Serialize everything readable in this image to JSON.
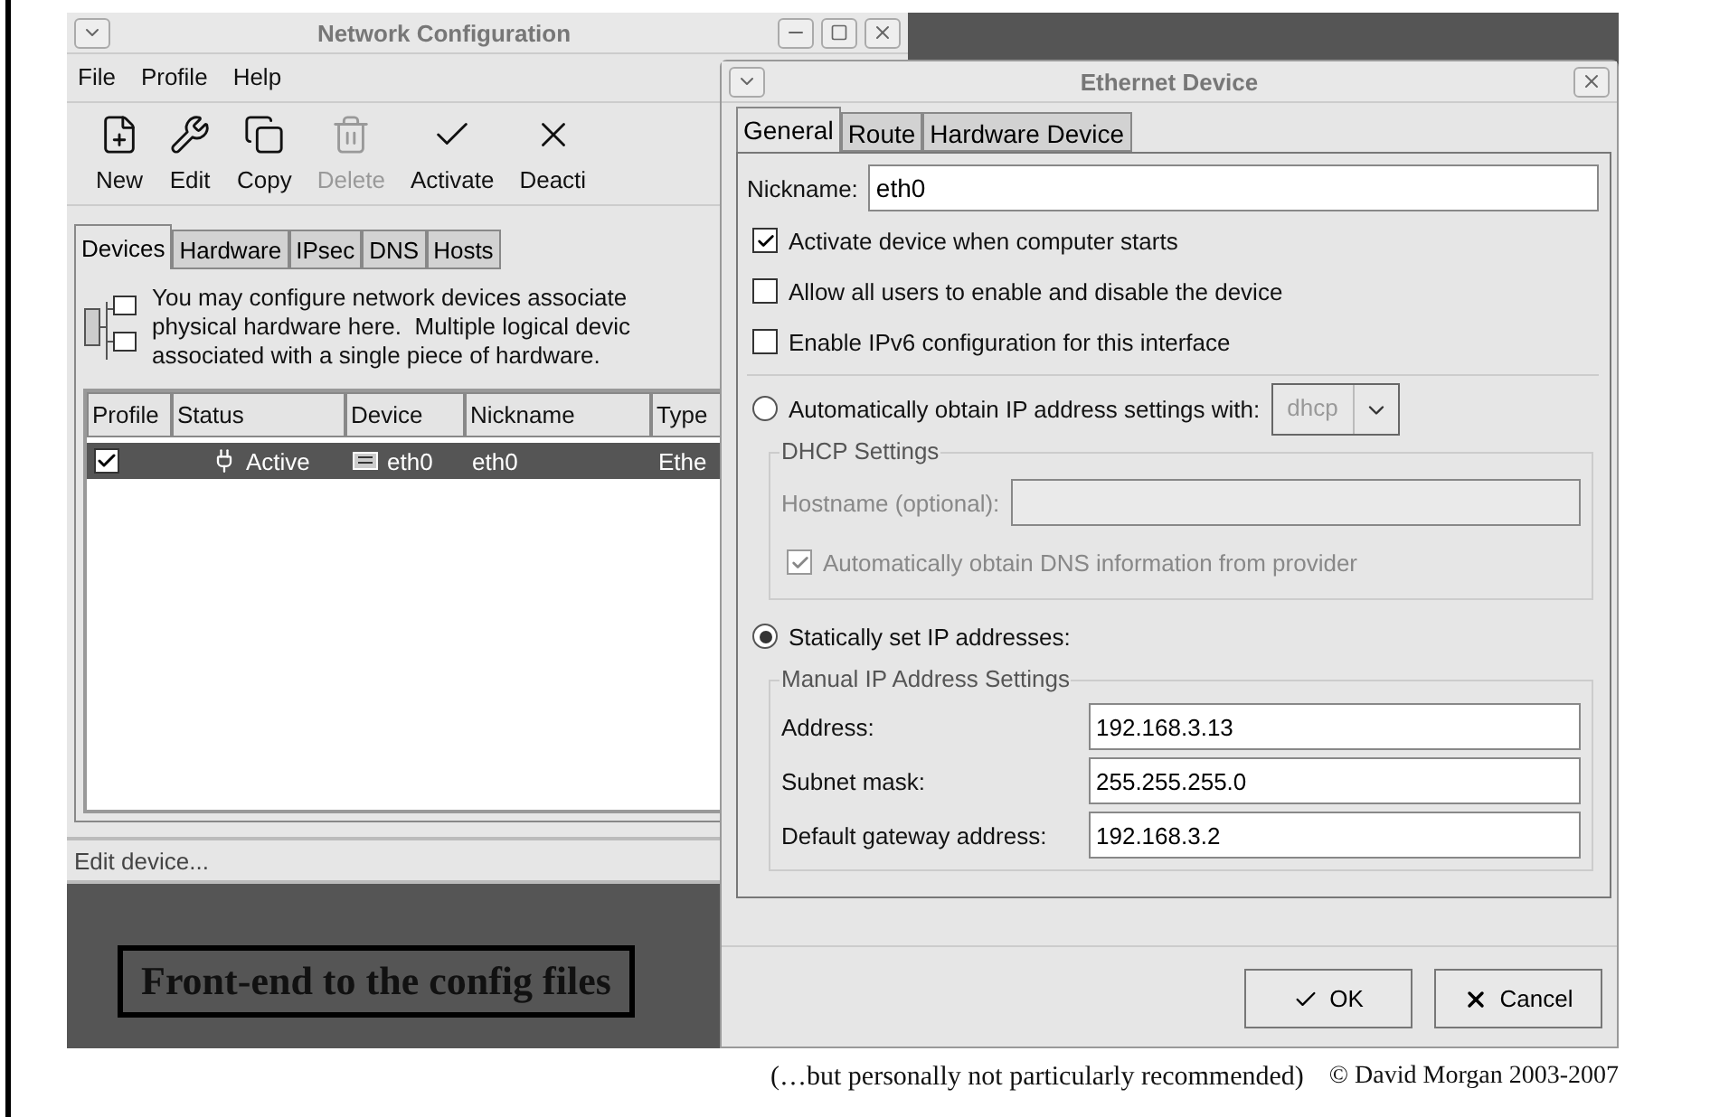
{
  "main_window": {
    "title": "Network Configuration",
    "menu": [
      "File",
      "Profile",
      "Help"
    ],
    "toolbar": [
      {
        "kind": "new",
        "label": "New",
        "disabled": false
      },
      {
        "kind": "edit",
        "label": "Edit",
        "disabled": false
      },
      {
        "kind": "copy",
        "label": "Copy",
        "disabled": false
      },
      {
        "kind": "delete",
        "label": "Delete",
        "disabled": true
      },
      {
        "kind": "activate",
        "label": "Activate",
        "disabled": false
      },
      {
        "kind": "deactivate",
        "label": "Deacti",
        "disabled": false
      }
    ],
    "tabs": [
      {
        "label": "Devices",
        "selected": true
      },
      {
        "label": "Hardware",
        "selected": false
      },
      {
        "label": "IPsec",
        "selected": false
      },
      {
        "label": "DNS",
        "selected": false
      },
      {
        "label": "Hosts",
        "selected": false
      }
    ],
    "info_lines": [
      "You may configure network devices associate",
      "physical hardware here.  Multiple logical devic",
      "associated with a single piece of hardware."
    ],
    "table": {
      "columns": [
        "Profile",
        "Status",
        "Device",
        "Nickname",
        "Type"
      ],
      "rows": [
        {
          "selected": true,
          "profile_checked": true,
          "status": "Active",
          "device": "eth0",
          "nickname": "eth0",
          "type": "Ethe"
        }
      ]
    },
    "status_bar": "Edit device..."
  },
  "dialog": {
    "title": "Ethernet Device",
    "tabs": [
      {
        "label": "General",
        "selected": true
      },
      {
        "label": "Route",
        "selected": false
      },
      {
        "label": "Hardware Device",
        "selected": false
      }
    ],
    "nickname": {
      "label": "Nickname:",
      "value": "eth0"
    },
    "checkboxes": [
      {
        "label": "Activate device when computer starts",
        "checked": true
      },
      {
        "label": "Allow all users to enable and disable the device",
        "checked": false
      },
      {
        "label": "Enable IPv6 configuration for this interface",
        "checked": false
      }
    ],
    "auto_ip": {
      "label": "Automatically obtain IP address settings with:",
      "selected": false,
      "combo": "dhcp"
    },
    "dhcp": {
      "title": "DHCP Settings",
      "disabled": true,
      "hostname_label": "Hostname (optional):",
      "dns": {
        "label": "Automatically obtain DNS information from provider",
        "checked": true
      }
    },
    "static_ip": {
      "label": "Statically set IP addresses:",
      "selected": true
    },
    "manual": {
      "title": "Manual IP Address Settings",
      "fields": [
        {
          "label": "Address:",
          "value": "192.168.3.13"
        },
        {
          "label": "Subnet mask:",
          "value": "255.255.255.0"
        },
        {
          "label": "Default gateway address:",
          "value": "192.168.3.2"
        }
      ]
    },
    "buttons": [
      {
        "kind": "ok",
        "label": "OK"
      },
      {
        "kind": "cancel",
        "label": "Cancel"
      }
    ]
  },
  "callout": "Front-end to the config files",
  "footer": {
    "note": "(…but personally not particularly recommended)",
    "copyright": "© David Morgan 2003-2007"
  }
}
